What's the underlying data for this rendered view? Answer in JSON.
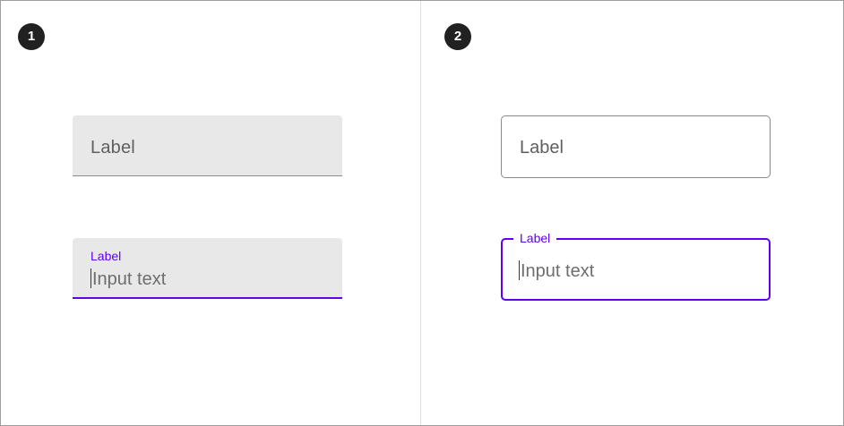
{
  "panels": [
    {
      "badge": "1",
      "fields": [
        {
          "state": "inactive",
          "label": "Label"
        },
        {
          "state": "focused",
          "label": "Label",
          "value": "Input text"
        }
      ]
    },
    {
      "badge": "2",
      "fields": [
        {
          "state": "inactive",
          "label": "Label"
        },
        {
          "state": "focused",
          "label": "Label",
          "value": "Input text"
        }
      ]
    }
  ],
  "colors": {
    "accent": "#6200ee",
    "filled_background": "#e8e8e8",
    "badge": "#212121"
  }
}
